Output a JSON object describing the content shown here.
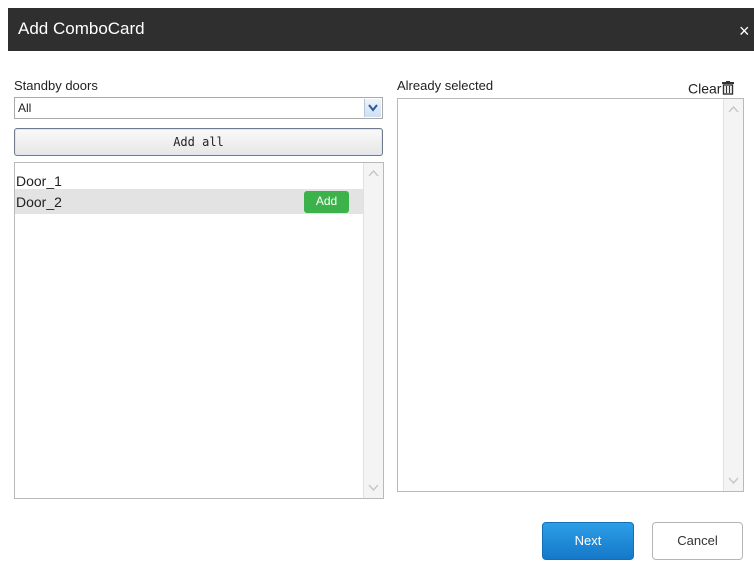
{
  "dialog": {
    "title": "Add ComboCard",
    "close_label": "×"
  },
  "standby": {
    "label": "Standby doors",
    "filter_value": "All",
    "add_all_label": "Add all",
    "doors": [
      {
        "name": "Door_1",
        "selected": false
      },
      {
        "name": "Door_2",
        "selected": true,
        "add_label": "Add"
      }
    ]
  },
  "selected": {
    "label": "Already selected",
    "clear_label": "Clear"
  },
  "footer": {
    "next_label": "Next",
    "cancel_label": "Cancel"
  },
  "colors": {
    "titlebar": "#2f2f2f",
    "add_button": "#3bb34a",
    "next_button": "#1f8bd9"
  },
  "icons": [
    "close-icon",
    "dropdown-arrow-icon",
    "trash-icon",
    "scroll-up-icon",
    "scroll-down-icon"
  ]
}
